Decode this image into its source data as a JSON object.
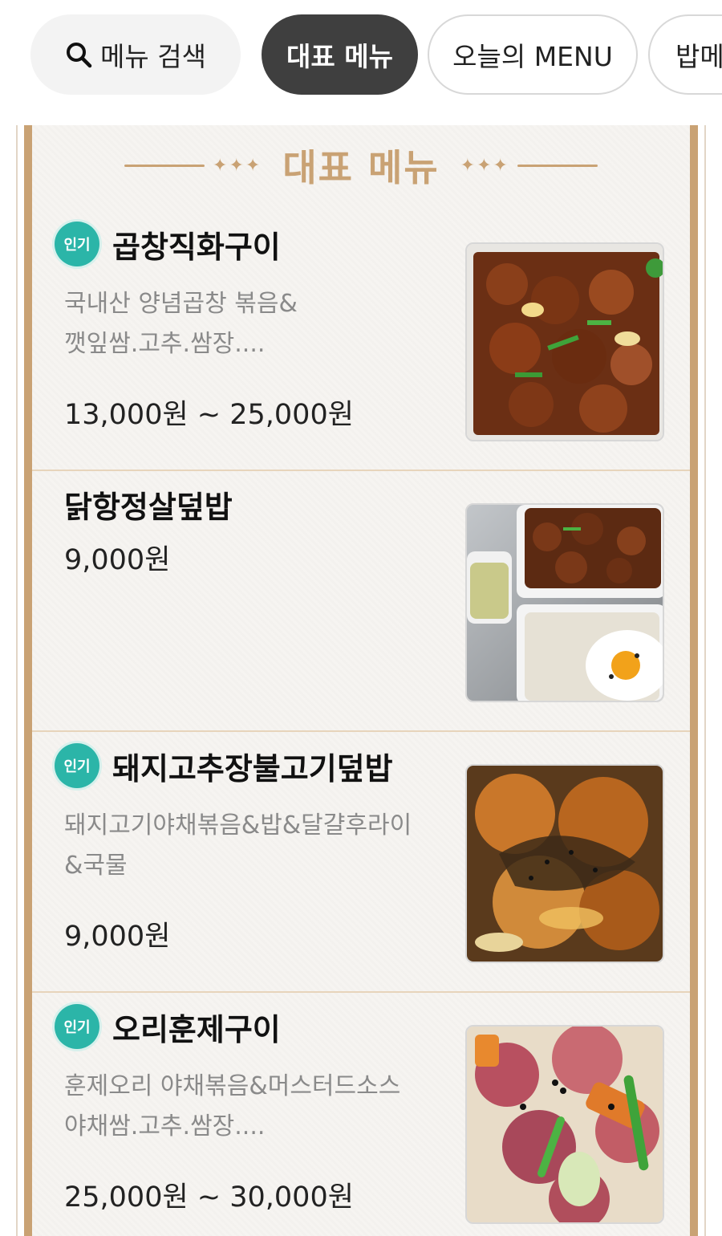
{
  "topbar": {
    "search_label": "메뉴 검색",
    "tabs": [
      {
        "label": "대표 메뉴",
        "active": true
      },
      {
        "label": "오늘의 MENU",
        "active": false
      },
      {
        "label": "밥메",
        "active": false
      }
    ]
  },
  "section": {
    "title": "대표 메뉴",
    "ornament": "✦✦✦"
  },
  "badge_label": "인기",
  "items": [
    {
      "name": "곱창직화구이",
      "popular": true,
      "desc_line1": "국내산 양념곱창 볶음&",
      "desc_line2": "깻잎쌈.고추.쌈장....",
      "price": "13,000원 ~ 25,000원",
      "image": "spicy-grilled-intestines-photo"
    },
    {
      "name": "닭항정살덮밥",
      "popular": false,
      "desc_line1": "",
      "desc_line2": "",
      "price": "9,000원",
      "image": "chicken-rice-bowl-photo"
    },
    {
      "name": "돼지고추장불고기덮밥",
      "popular": true,
      "desc_line1": "돼지고기야채볶음&밥&달걀후라이",
      "desc_line2": "&국물",
      "price": "9,000원",
      "image": "pork-bulgogi-rice-bowl-photo"
    },
    {
      "name": "오리훈제구이",
      "popular": true,
      "desc_line1": "훈제오리 야채볶음&머스터드소스",
      "desc_line2": "야채쌈.고추.쌈장....",
      "price": "25,000원 ~ 30,000원",
      "image": "smoked-duck-photo"
    }
  ],
  "colors": {
    "accent": "#c9a274",
    "badge": "#2bb5a8",
    "active_tab": "#3f3f3f"
  }
}
